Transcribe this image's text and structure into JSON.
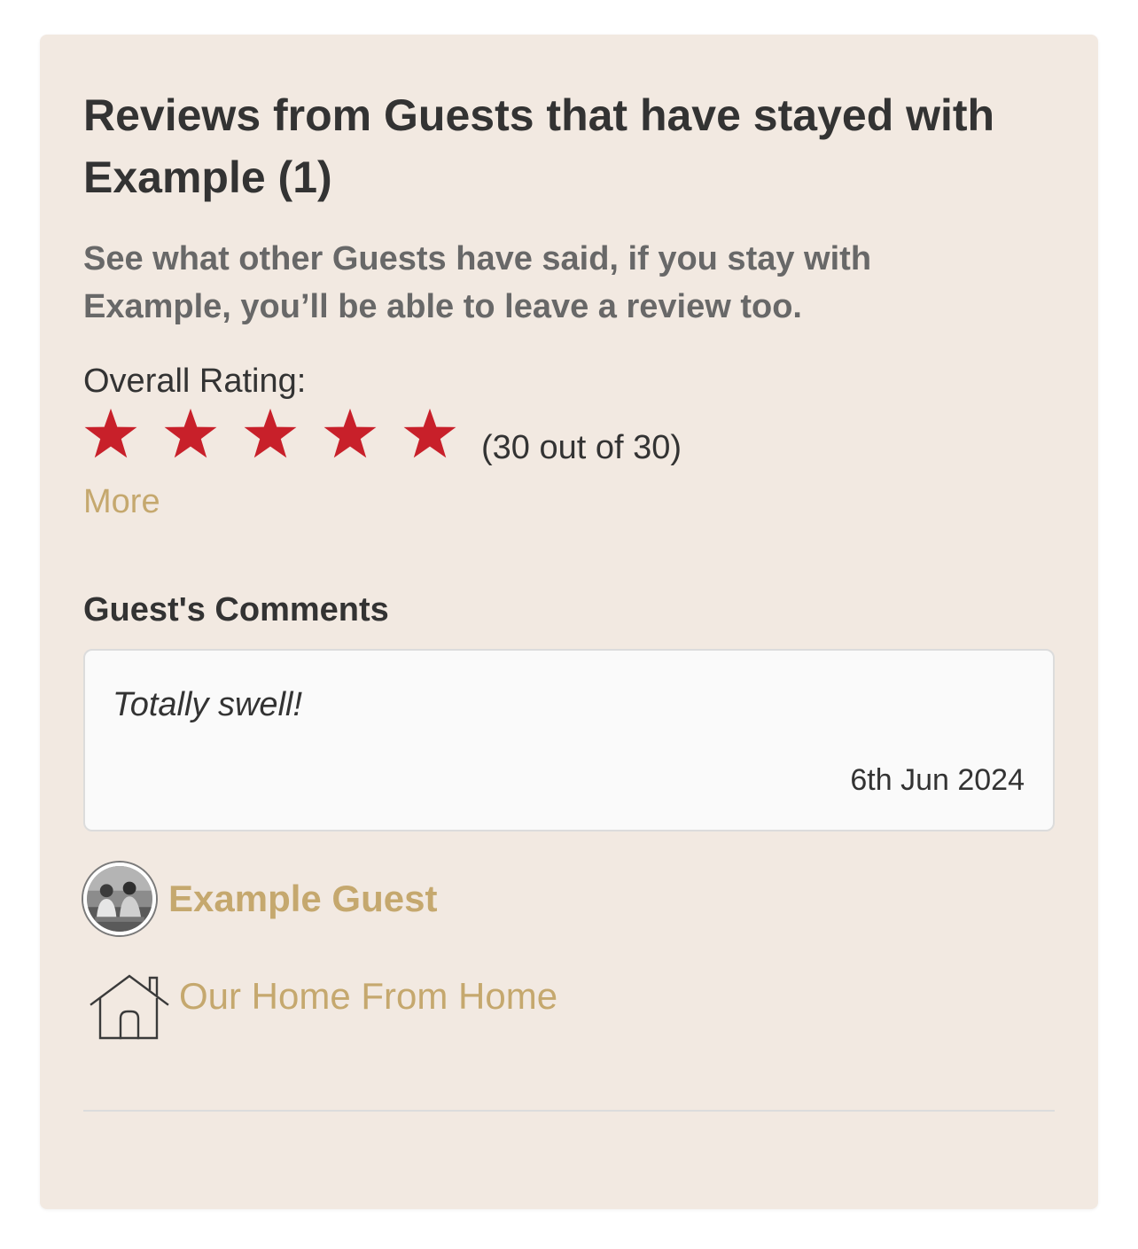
{
  "reviews": {
    "title": "Reviews from Guests that have stayed with Example (1)",
    "subtitle": "See what other Guests have said, if you stay with Example, you’ll be able to leave a review too.",
    "overall_rating_label": "Overall Rating:",
    "stars_filled": 5,
    "stars_total": 5,
    "star_icon": "star-icon",
    "star_color": "#c8202a",
    "rating_value_text": "(30 out of 30)",
    "more_label": "More",
    "comments_heading": "Guest's Comments",
    "comment": {
      "text": "Totally swell!",
      "date": "6th Jun 2024"
    },
    "guest": {
      "name": "Example Guest",
      "avatar_icon": "avatar-photo"
    },
    "property": {
      "icon": "house-icon",
      "name": "Our Home From Home"
    }
  },
  "colors": {
    "card_background": "#f2e9e1",
    "accent_link": "#c5a86e",
    "heading_text": "#333333",
    "muted_text": "#686868"
  }
}
